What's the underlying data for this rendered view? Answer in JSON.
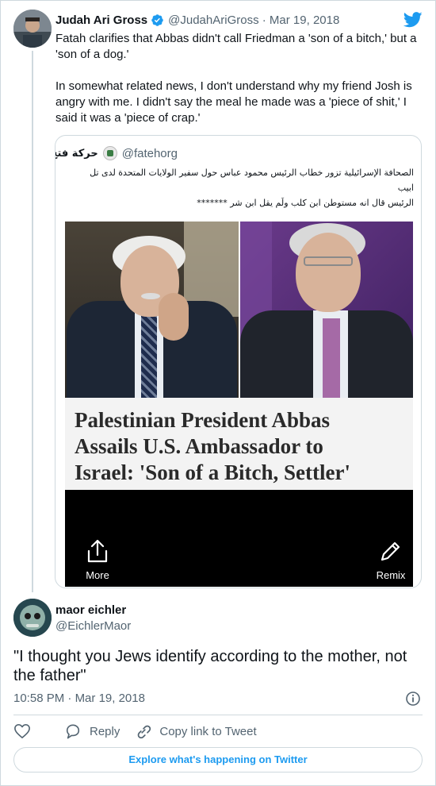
{
  "parent": {
    "name": "Judah Ari Gross",
    "handle": "@JudahAriGross",
    "date": "Mar 19, 2018",
    "date_sep": " · ",
    "paragraphs": [
      "Fatah clarifies that Abbas didn't call Friedman a 'son of a bitch,' but a 'son of a dog.'",
      "In somewhat related news, I don't understand why my friend Josh is angry with me. I didn't say the meal he made was a 'piece of shit,' I said it was a 'piece of crap.'"
    ],
    "icons": {
      "verified": "verified-badge-icon",
      "brand": "twitter-bird-icon"
    },
    "colors": {
      "brand": "#1d9bf0",
      "secondary_text": "#536471"
    }
  },
  "quoted": {
    "name": "حركة فتح",
    "handle": "@fatehorg",
    "lines": [
      "الصحافة الإسرائيلية تزور خطاب الرئيس محمود عباس حول  سفير الولايات المتحدة لدى تل",
      "ابيب",
      "الرئيس قال انه مستوطن ابن كلب ولَم يقل ابن شر *******"
    ],
    "headline_lines": [
      "Palestinian President Abbas",
      "Assails U.S. Ambassador to",
      "Israel: 'Son of a Bitch, Settler'"
    ],
    "actions": {
      "more": "More",
      "remix": "Remix"
    }
  },
  "reply": {
    "name": "maor eichler",
    "handle": "@EichlerMaor",
    "text": "\"I thought you Jews identify according to the mother, not the father\"",
    "time": "10:58 PM",
    "date": "Mar 19, 2018",
    "meta_sep": " · "
  },
  "actions": {
    "reply": "Reply",
    "copy_link": "Copy link to Tweet",
    "explore": "Explore what's happening on Twitter"
  }
}
